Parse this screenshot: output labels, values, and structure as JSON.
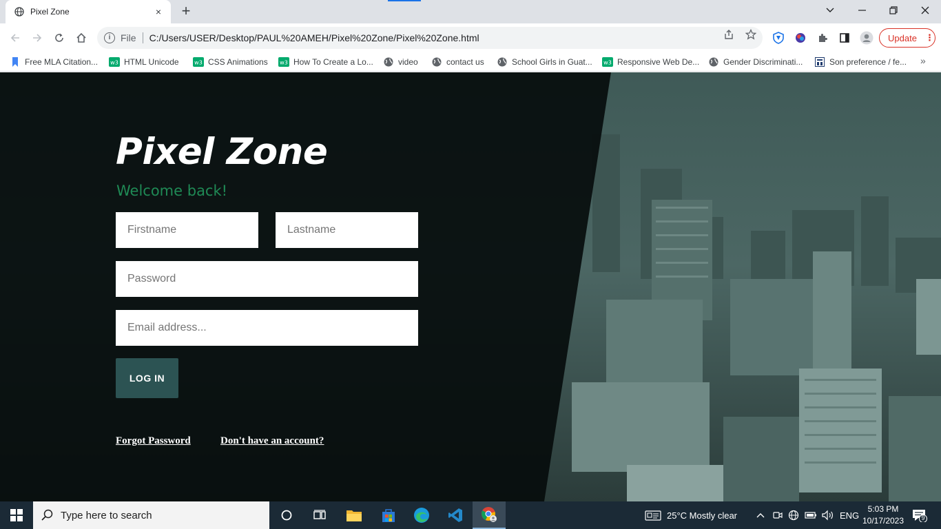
{
  "browser": {
    "tab": {
      "title": "Pixel Zone",
      "favicon": "globe-icon",
      "close": "×"
    },
    "new_tab": "+",
    "window_buttons": [
      "chevron-down-icon",
      "minimize-icon",
      "restore-icon",
      "close-icon"
    ],
    "address": {
      "scheme": "File",
      "url": "C:/Users/USER/Desktop/PAUL%20AMEH/Pixel%20Zone/Pixel%20Zone.html"
    },
    "update_label": "Update",
    "bookmarks": [
      {
        "label": "Free MLA Citation...",
        "icon": "bookmark-icon"
      },
      {
        "label": "HTML Unicode",
        "icon": "w3-icon"
      },
      {
        "label": "CSS Animations",
        "icon": "w3-icon"
      },
      {
        "label": "How To Create a Lo...",
        "icon": "w3-icon"
      },
      {
        "label": "video",
        "icon": "globe-icon"
      },
      {
        "label": "contact us",
        "icon": "globe-icon"
      },
      {
        "label": "School Girls in Guat...",
        "icon": "globe-icon"
      },
      {
        "label": "Responsive Web De...",
        "icon": "w3-icon"
      },
      {
        "label": "Gender Discriminati...",
        "icon": "globe-icon"
      },
      {
        "label": "Son preference / fe...",
        "icon": "doc-icon"
      }
    ],
    "bookmarks_more": "»"
  },
  "page": {
    "brand": "Pixel Zone",
    "welcome": "Welcome back!",
    "fields": {
      "firstname_placeholder": "Firstname",
      "lastname_placeholder": "Lastname",
      "password_placeholder": "Password",
      "email_placeholder": "Email address..."
    },
    "login_label": "LOG IN",
    "forgot_password": "Forgot Password",
    "no_account": "Don't have an account?",
    "colors": {
      "brand_text": "#ffffff",
      "welcome_text": "#1f8a55",
      "button_bg": "#2c5353"
    }
  },
  "taskbar": {
    "search_placeholder": "Type here to search",
    "weather": "25°C  Mostly clear",
    "language": "ENG",
    "time": "5:03 PM",
    "date": "10/17/2023",
    "notification_count": "9"
  }
}
